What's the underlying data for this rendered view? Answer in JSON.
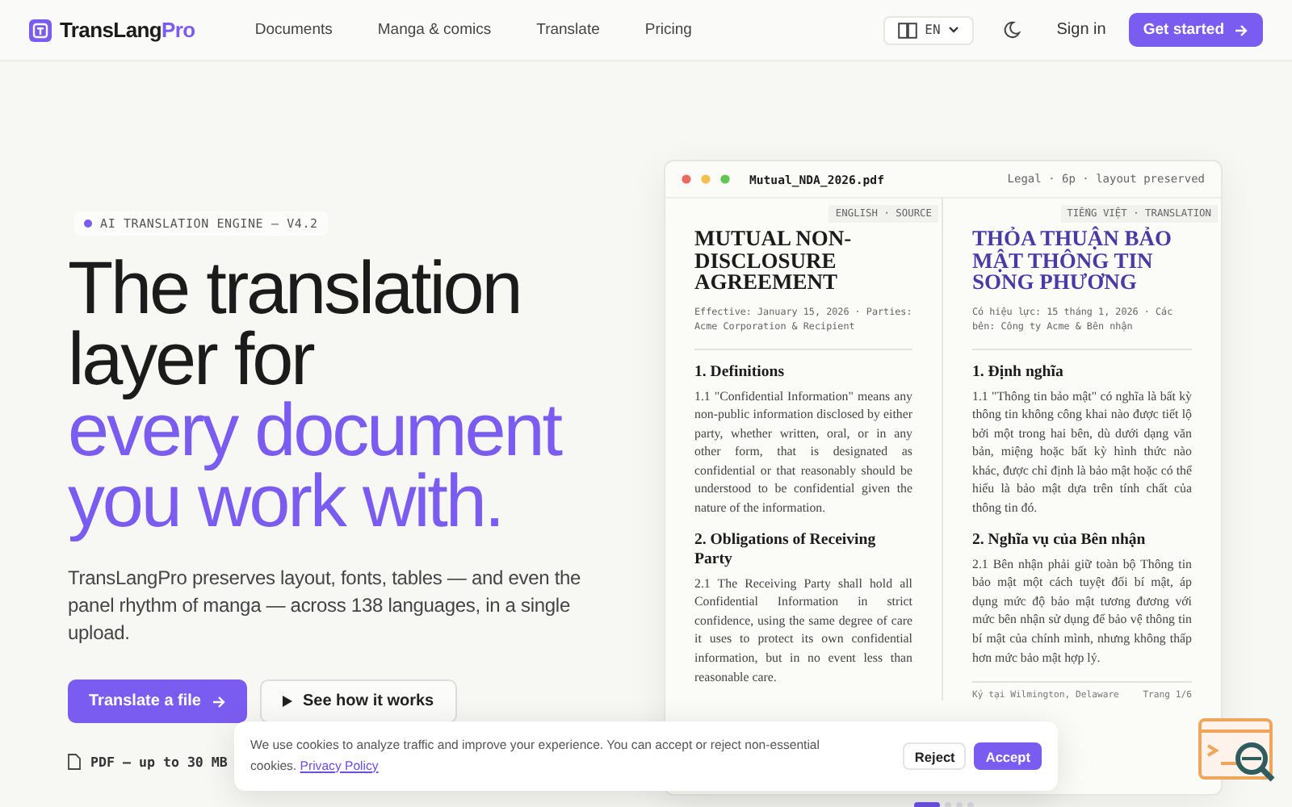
{
  "brand": {
    "name": "TransLang",
    "accent": "Pro"
  },
  "nav": [
    "Documents",
    "Manga & comics",
    "Translate",
    "Pricing"
  ],
  "language": {
    "code": "EN"
  },
  "sign_in": "Sign in",
  "get_started": "Get started",
  "badge": "AI TRANSLATION ENGINE — V4.2",
  "headline": {
    "lead": "The translation layer for",
    "accent": "every document you work with."
  },
  "intro": "TransLangPro preserves layout, fonts, tables — and even the panel rhythm of manga — across 138 languages, in a single upload.",
  "primary_button": "Translate a file",
  "secondary_button": "See how it works",
  "file_note": "PDF — up to 30 MB",
  "document": {
    "filename": "Mutual_NDA_2026.pdf",
    "meta": "Legal · 6p · layout preserved",
    "columns": [
      {
        "kind": "source",
        "label": "ENGLISH · SOURCE",
        "title": "MUTUAL NON-DISCLOSURE AGREEMENT",
        "meta": "Effective: January 15, 2026 · Parties: Acme Corporation & Recipient",
        "sections": [
          {
            "heading": "1. Definitions",
            "body": "1.1 \"Confidential Information\" means any non-public information disclosed by either party, whether written, oral, or in any other form, that is designated as confidential or that reasonably should be understood to be confidential given the nature of the information."
          },
          {
            "heading": "2. Obligations of Receiving Party",
            "body": "2.1 The Receiving Party shall hold all Confidential Information in strict confidence, using the same degree of care it uses to protect its own confidential information, but in no event less than reasonable care."
          }
        ]
      },
      {
        "kind": "translation",
        "label": "TIẾNG VIỆT · TRANSLATION",
        "title": "THỎA THUẬN BẢO MẬT THÔNG TIN SONG PHƯƠNG",
        "meta": "Có hiệu lực: 15 tháng 1, 2026 · Các bên: Công ty Acme & Bên nhận",
        "sections": [
          {
            "heading": "1. Định nghĩa",
            "body": "1.1 \"Thông tin bảo mật\" có nghĩa là bất kỳ thông tin không công khai nào được tiết lộ bởi một trong hai bên, dù dưới dạng văn bản, miệng hoặc bất kỳ hình thức nào khác, được chỉ định là bảo mật hoặc có thể hiểu là bảo mật dựa trên tính chất của thông tin đó."
          },
          {
            "heading": "2. Nghĩa vụ của Bên nhận",
            "body": "2.1 Bên nhận phải giữ toàn bộ Thông tin bảo mật một cách tuyệt đối bí mật, áp dụng mức độ bảo mật tương đương với mức bên nhận sử dụng để bảo vệ thông tin bí mật của chính mình, nhưng không thấp hơn mức bảo mật hợp lý."
          }
        ],
        "footer": {
          "left": "Ký tại Wilmington, Delaware",
          "right": "Trang 1/6"
        }
      }
    ]
  },
  "slides": [
    {
      "selected": true
    },
    {
      "selected": false
    },
    {
      "selected": false
    },
    {
      "selected": false
    }
  ],
  "cookie": {
    "text": "We use cookies to analyze traffic and improve your experience. You can accept or reject non-essential cookies.",
    "link": "Privacy Policy",
    "reject": "Reject",
    "accept": "Accept"
  }
}
